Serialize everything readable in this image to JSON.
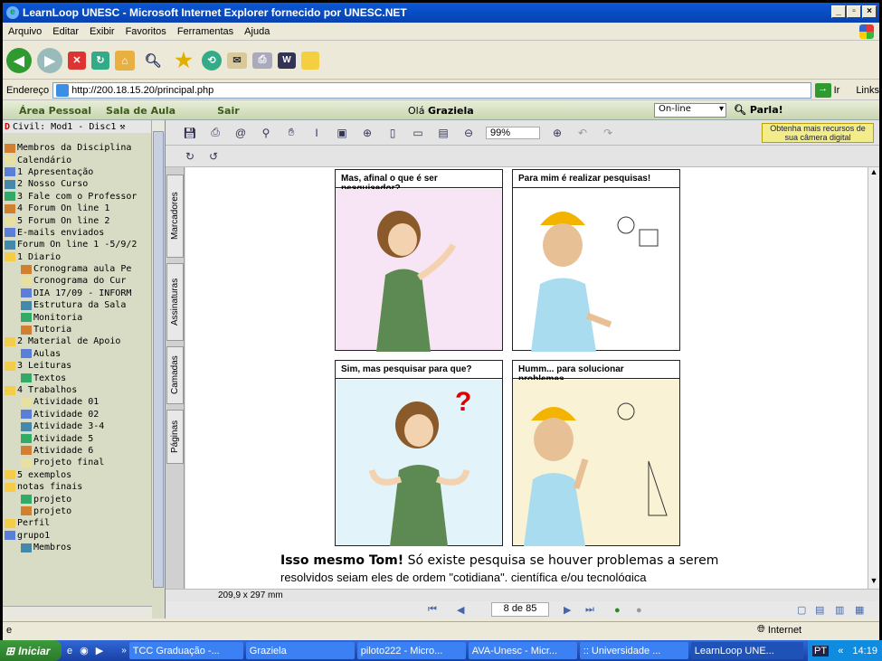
{
  "window": {
    "title": "LearnLoop UNESC - Microsoft Internet Explorer fornecido por UNESC.NET"
  },
  "menu": [
    "Arquivo",
    "Editar",
    "Exibir",
    "Favoritos",
    "Ferramentas",
    "Ajuda"
  ],
  "address": {
    "label": "Endereço",
    "url": "http://200.18.15.20/principal.php",
    "go": "Ir",
    "links": "Links"
  },
  "site_nav": {
    "area_pessoal": "Área Pessoal",
    "sala_de_aula": "Sala de Aula",
    "sair": "Sair",
    "greeting": "Olá",
    "user": "Graziela",
    "status": "On-line",
    "fala": "Parla!"
  },
  "sidebar": {
    "header": "Civil: Mod1 - Disc1",
    "items": [
      "Membros da Disciplina",
      "Calendário",
      "1 Apresentação",
      "2 Nosso Curso",
      "3 Fale com o Professor",
      "4 Forum On line 1",
      "5 Forum On line 2",
      "E-mails enviados",
      "Forum On line 1 -5/9/2",
      "1 Diario",
      "Cronograma aula Pe",
      "Cronograma do Cur",
      "DIA 17/09 - INFORM",
      "Estrutura da Sala",
      "Monitoria",
      "Tutoria",
      "2 Material de Apoio",
      "Aulas",
      "3 Leituras",
      "Textos",
      "4 Trabalhos",
      "Atividade 01",
      "Atividade 02",
      "Atividade 3-4",
      "Atividade 5",
      "Atividade 6",
      "Projeto final",
      "5 exemplos",
      "notas finais",
      "projeto",
      "projeto",
      "Perfil",
      "grupo1",
      "Membros"
    ]
  },
  "viewer": {
    "zoom": "99%",
    "ad": "Obtenha mais recursos de sua câmera digital",
    "tabs": [
      "Marcadores",
      "Assinaturas",
      "Camadas",
      "Páginas"
    ],
    "page_size": "209,9 x 297 mm",
    "page_indicator": "8 de 85"
  },
  "comic": {
    "p1": "Mas, afinal o que é ser pesquisador?",
    "p2": "Para mim é realizar pesquisas!",
    "p3": "Sim, mas pesquisar para que?",
    "p4": "Humm... para solucionar problemas.",
    "caption_bold": "Isso mesmo Tom!",
    "caption": "Só existe pesquisa se houver problemas a serem",
    "caption2": "resolvidos sejam eles de ordem \"cotidiana\", científica e/ou tecnológica"
  },
  "status": {
    "zone": "Internet"
  },
  "taskbar": {
    "start": "Iniciar",
    "tasks": [
      "TCC Graduação -...",
      "Graziela",
      "piloto222 - Micro...",
      "AVA-Unesc - Micr...",
      ":: Universidade ...",
      "LearnLoop UNE..."
    ],
    "lang": "PT",
    "time": "14:19"
  },
  "colors": {
    "title_bar": "#0a58d6",
    "taskbar": "#3168d5",
    "start": "#3c9a3c",
    "ad_bg": "#f2ec8a"
  }
}
